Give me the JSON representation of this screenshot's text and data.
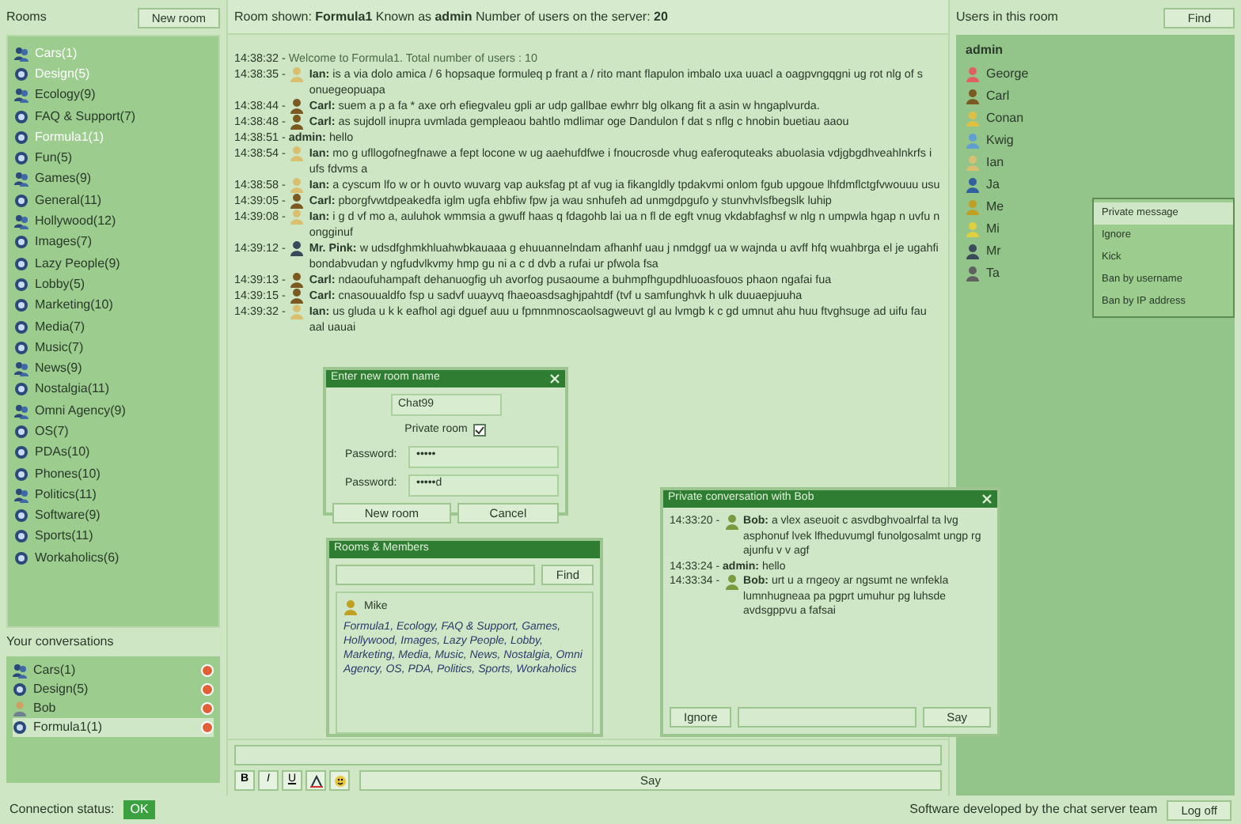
{
  "rooms_panel": {
    "title": "Rooms",
    "new_room_button": "New room",
    "rooms": [
      {
        "name": "Cars(1)",
        "kind": "group",
        "joined": true
      },
      {
        "name": "Design(5)",
        "kind": "room",
        "joined": true
      },
      {
        "name": "Ecology(9)",
        "kind": "group",
        "joined": false
      },
      {
        "name": "FAQ & Support(7)",
        "kind": "room",
        "joined": false
      },
      {
        "name": "Formula1(1)",
        "kind": "room",
        "joined": true
      },
      {
        "name": "Fun(5)",
        "kind": "room",
        "joined": false
      },
      {
        "name": "Games(9)",
        "kind": "group",
        "joined": false
      },
      {
        "name": "General(11)",
        "kind": "room",
        "joined": false
      },
      {
        "name": "Hollywood(12)",
        "kind": "group",
        "joined": false
      },
      {
        "name": "Images(7)",
        "kind": "room",
        "joined": false
      },
      {
        "name": "Lazy People(9)",
        "kind": "room",
        "joined": false
      },
      {
        "name": "Lobby(5)",
        "kind": "room",
        "joined": false
      },
      {
        "name": "Marketing(10)",
        "kind": "room",
        "joined": false
      },
      {
        "name": "Media(7)",
        "kind": "room",
        "joined": false
      },
      {
        "name": "Music(7)",
        "kind": "room",
        "joined": false
      },
      {
        "name": "News(9)",
        "kind": "group",
        "joined": false
      },
      {
        "name": "Nostalgia(11)",
        "kind": "room",
        "joined": false
      },
      {
        "name": "Omni Agency(9)",
        "kind": "group",
        "joined": false
      },
      {
        "name": "OS(7)",
        "kind": "room",
        "joined": false
      },
      {
        "name": "PDAs(10)",
        "kind": "room",
        "joined": false
      },
      {
        "name": "Phones(10)",
        "kind": "room",
        "joined": false
      },
      {
        "name": "Politics(11)",
        "kind": "group",
        "joined": false
      },
      {
        "name": "Software(9)",
        "kind": "room",
        "joined": false
      },
      {
        "name": "Sports(11)",
        "kind": "room",
        "joined": false
      },
      {
        "name": "Workaholics(6)",
        "kind": "room",
        "joined": false
      }
    ]
  },
  "conversations": {
    "title": "Your conversations",
    "items": [
      {
        "name": "Cars(1)",
        "kind": "group",
        "selected": false
      },
      {
        "name": "Design(5)",
        "kind": "room",
        "selected": false
      },
      {
        "name": "Bob",
        "kind": "user",
        "selected": false
      },
      {
        "name": "Formula1(1)",
        "kind": "room",
        "selected": true
      }
    ]
  },
  "connection": {
    "label": "Connection status:",
    "value": "OK",
    "connected": true
  },
  "info_bar": "Room shown: **Formula1**  Known as **admin**  Number of users on the server: **20**",
  "messages": [
    {
      "time": "14:38:32 -",
      "kind": "system",
      "text": "Welcome to Formula1. Total number of users : 10"
    },
    {
      "time": "14:38:35 -",
      "kind": "user",
      "user": "Ian:",
      "color": "#d8c070",
      "text": "is a via dolo amica / 6 hopsaque formuleq p frant a / rito mant flapulon imbalo uxa uuacl a oagpvngqgni ug rot nlg of s onuegeopuapa"
    },
    {
      "time": "14:38:44 -",
      "kind": "user",
      "user": "Carl:",
      "color": "#7a5a20",
      "text": "suem a p a fa * axe orh efiegvaleu gpli ar udp gallbae ewhrr blg olkang fit a asin w hngaplvurda."
    },
    {
      "time": "14:38:48 -",
      "kind": "user",
      "user": "Carl:",
      "color": "#7a5a20",
      "text": "as sujdoll inupra uvmlada gempleaou bahtlo mdlimar oge Dandulon f dat s nflg c hnobin buetiau aaou"
    },
    {
      "time": "14:38:51 -",
      "kind": "user",
      "user": "admin:",
      "text": "hello"
    },
    {
      "time": "14:38:54 -",
      "kind": "user",
      "user": "Ian:",
      "color": "#d8c070",
      "text": "mo g ufllogofnegfnawe a fept locone w ug aaehufdfwe i fnoucrosde vhug eaferoquteaks abuolasia vdjgbgdhveahlnkrfs i ufs fdvms a"
    },
    {
      "time": "14:38:58 -",
      "kind": "user",
      "user": "Ian:",
      "color": "#d8c070",
      "text": "a cyscum lfo w or h ouvto wuvarg vap auksfag pt af vug ia fikangldly tpdakvmi onlom fgub upgoue lhfdmflctgfvwouuu usu"
    },
    {
      "time": "14:39:05 -",
      "kind": "user",
      "user": "Carl:",
      "color": "#7a5a20",
      "text": "pborgfvwtdpeakedfa iglm ugfa ehbfiw fpw ja wau snhufeh ad unmgdpgufo y stunvhvlsfbegslk luhip"
    },
    {
      "time": "14:39:08 -",
      "kind": "user",
      "user": "Ian:",
      "color": "#d8c070",
      "text": "i g d vf mo a, auluhok wmmsia a gwuff haas q fdagohb lai ua n fl de egft vnug vkdabfaghsf w nlg n umpwla hgap n uvfu n ongginuf"
    },
    {
      "time": "14:39:12 -",
      "kind": "user",
      "user": "Mr. Pink:",
      "color": "#3a4a5a",
      "text": "w udsdfghmkhluahwbkauaaa g ehuuannelndam afhanhf uau j nmdggf ua w wajnda u avff hfq wuahbrga el je ugahfi bondabvudan y ngfudvlkvmy hmp gu ni a c d dvb a rufai ur pfwola fsa"
    },
    {
      "time": "14:39:13 -",
      "kind": "user",
      "user": "Carl:",
      "color": "#7a5a20",
      "text": "ndaoufuhampaft dehanuogfig uh avorfog pusaoume a buhmpfhgupdhluoasfouos phaon ngafai fua"
    },
    {
      "time": "14:39:15 -",
      "kind": "user",
      "user": "Carl:",
      "color": "#7a5a20",
      "text": "cnasouualdfo fsp u sadvf uuayvq fhaeoasdsaghjpahtdf (tvf u samfunghvk h ulk duuaepjuuha"
    },
    {
      "time": "14:39:32 -",
      "kind": "user",
      "user": "Ian:",
      "color": "#d8c070",
      "text": "us gluda u k k eafhol agi dguef auu u fpmnmnoscaolsagweuvt gl au lvmgb k c gd umnut ahu huu ftvghsuge ad uifu fau aal uauai"
    }
  ],
  "new_room_dialog": {
    "title": "Enter new room name",
    "room_name": "Chat99",
    "private_label": "Private room",
    "private": true,
    "password_label": "Password:",
    "password": "•••••",
    "confirm_label": "Password:",
    "confirm": "•••••d",
    "ok_button": "New room",
    "cancel_button": "Cancel"
  },
  "members_dialog": {
    "title": "Rooms & Members",
    "find_button": "Find",
    "member": "Mike",
    "rooms_text": "Formula1, Ecology, FAQ & Support, Games, Hollywood, Images, Lazy People, Lobby, Marketing, Media, Music, News, Nostalgia, Omni Agency, OS, PDA, Politics, Sports, Workaholics"
  },
  "private_dialog": {
    "title": "Private conversation with Bob",
    "messages": [
      {
        "time": "14:33:20 -",
        "user": "Bob:",
        "color": "#7a9a40",
        "text": "a vlex aseuoit c asvdbghvoalrfal ta lvg asphonuf lvek lfheduvumgl funolgosalmt ungp rg ajunfu v v agf"
      },
      {
        "time": "14:33:24 -",
        "user": "admin:",
        "text": "hello"
      },
      {
        "time": "14:33:34 -",
        "user": "Bob:",
        "color": "#7a9a40",
        "text": "urt u a rngeoy ar ngsumt ne wnfekla lumnhugneaa pa pgprt umuhur pg luhsde avdsgppvu a fafsai"
      }
    ],
    "ignore_button": "Ignore",
    "say_button": "Say"
  },
  "composer": {
    "tools": [
      {
        "kind": "bold",
        "label": "B"
      },
      {
        "kind": "italic",
        "label": "I"
      },
      {
        "kind": "underline",
        "label": "U"
      },
      {
        "kind": "color"
      },
      {
        "kind": "smiley"
      }
    ],
    "say_button": "Say"
  },
  "users_panel": {
    "title": "Users in this room",
    "find_button": "Find",
    "header": "admin",
    "users": [
      {
        "name": "George",
        "color": "#e06060"
      },
      {
        "name": "Carl",
        "color": "#7a5a20"
      },
      {
        "name": "Conan",
        "color": "#e0c040"
      },
      {
        "name": "Kwig",
        "color": "#60a0d0"
      },
      {
        "name": "Ian",
        "color": "#d8c070"
      },
      {
        "name": "Ja",
        "color": "#3060a0"
      },
      {
        "name": "Me",
        "color": "#c0a020"
      },
      {
        "name": "Mi",
        "color": "#e0d040"
      },
      {
        "name": "Mr",
        "color": "#3a4a5a"
      },
      {
        "name": "Ta",
        "color": "#606060"
      }
    ]
  },
  "context_menu": {
    "items": [
      {
        "label": "Private message",
        "selected": true
      },
      {
        "label": "Ignore",
        "selected": false
      },
      {
        "label": "Kick",
        "selected": false
      },
      {
        "label": "Ban by username",
        "selected": false
      },
      {
        "label": "Ban by IP address",
        "selected": false
      }
    ]
  },
  "footer": {
    "credit": "Software developed by the chat server team",
    "logoff_button": "Log off"
  }
}
